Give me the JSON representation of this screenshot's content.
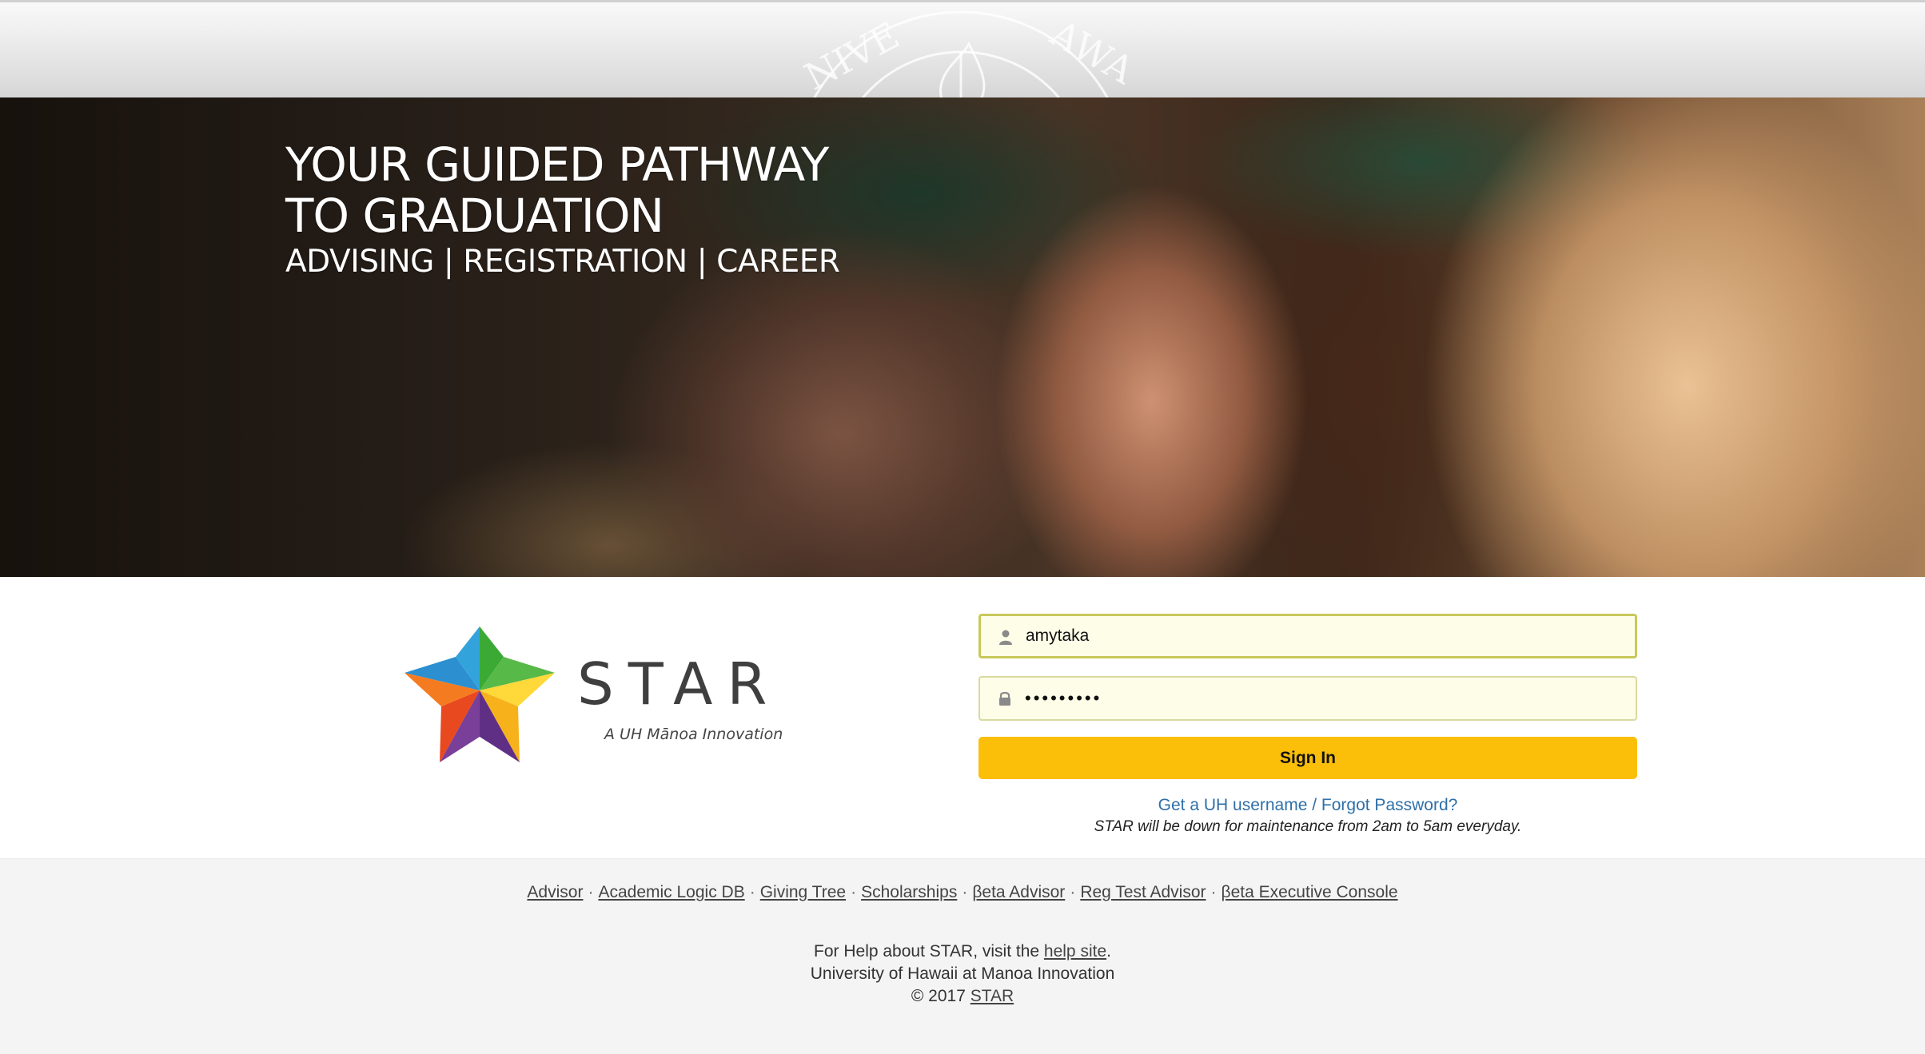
{
  "hero": {
    "line1": "YOUR GUIDED PATHWAY",
    "line2": "TO GRADUATION",
    "subtitle": "ADVISING | REGISTRATION | CAREER"
  },
  "logo": {
    "name": "STAR",
    "tagline": "A UH Mānoa Innovation",
    "star_colors": [
      "#33a3dc",
      "#3aaa35",
      "#f7b11a",
      "#ffd83a",
      "#7a3f98",
      "#f15a24"
    ]
  },
  "login": {
    "username_value": "amytaka",
    "password_value": "•••••••••",
    "signin_label": "Sign In",
    "forgot_link": "Get a UH username / Forgot Password?",
    "maintenance_note": "STAR will be down for maintenance from 2am to 5am everyday."
  },
  "footer": {
    "links": [
      "Advisor",
      "Academic Logic DB",
      "Giving Tree",
      "Scholarships",
      "βeta Advisor",
      "Reg Test Advisor",
      "βeta Executive Console"
    ],
    "separator": "·",
    "help_prefix": "For Help about STAR, visit the ",
    "help_link": "help site",
    "help_suffix": ".",
    "university": "University of Hawaii at Manoa Innovation",
    "copyright_prefix": "© 2017 ",
    "copyright_link": "STAR"
  },
  "colors": {
    "signin_button": "#fbbf09",
    "link_blue": "#2f6fa8",
    "input_background": "#fdfde8"
  },
  "icons": {
    "username_field": "user-icon",
    "password_field": "lock-icon"
  }
}
